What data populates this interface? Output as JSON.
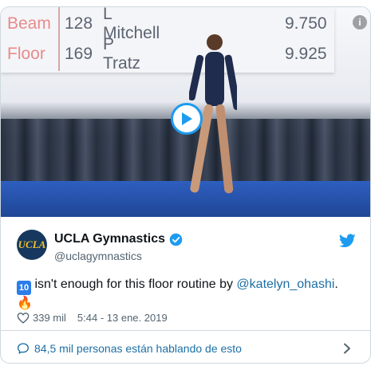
{
  "media": {
    "scoreboard": [
      {
        "event": "Beam",
        "number": "128",
        "name": "L Mitchell",
        "score": "9.750"
      },
      {
        "event": "Floor",
        "number": "169",
        "name": "P Tratz",
        "score": "9.925"
      }
    ],
    "info_glyph": "i"
  },
  "tweet": {
    "avatar_text": "UCLA",
    "display_name": "UCLA Gymnastics",
    "handle": "@uclagymnastics",
    "text_emoji": "10",
    "text_before": " isn't enough for this floor routine by ",
    "mention": "@katelyn_ohashi",
    "text_after": ".",
    "text_emoji_end": "🔥",
    "likes": "339 mil",
    "timestamp": "5:44 - 13 ene. 2019",
    "conversation": "84,5 mil personas están hablando de esto"
  },
  "colors": {
    "accent": "#1d9bf0",
    "link": "#1d6fa5",
    "avatar_bg": "#16385e",
    "avatar_text": "#f2c230"
  },
  "icons": [
    "info-icon",
    "play-icon",
    "verified-badge-icon",
    "twitter-bird-icon",
    "heart-icon",
    "comment-icon",
    "chevron-right-icon"
  ]
}
